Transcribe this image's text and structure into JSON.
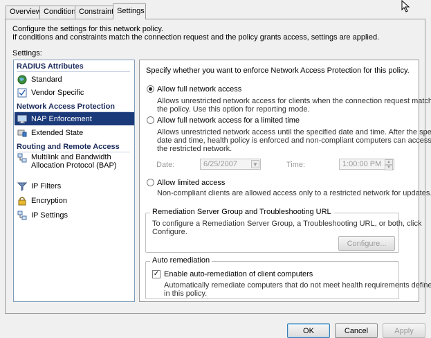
{
  "tabs": [
    {
      "label": "Overview"
    },
    {
      "label": "Conditions"
    },
    {
      "label": "Constraints"
    },
    {
      "label": "Settings",
      "active": true
    }
  ],
  "intro": {
    "line1": "Configure the settings for this network policy.",
    "line2": "If conditions and constraints match the connection request and the policy grants access, settings are applied."
  },
  "settings_label": "Settings:",
  "nav": {
    "sections": [
      {
        "label": "RADIUS Attributes"
      },
      {
        "label": "Network Access Protection"
      },
      {
        "label": "Routing and Remote Access"
      }
    ],
    "items": [
      {
        "label": "Standard",
        "icon": "globe-icon"
      },
      {
        "label": "Vendor Specific",
        "icon": "checklist-icon"
      },
      {
        "label": "NAP Enforcement",
        "icon": "monitor-icon",
        "selected": true
      },
      {
        "label": "Extended State",
        "icon": "flag-icon"
      },
      {
        "label": "Multilink and Bandwidth Allocation Protocol (BAP)",
        "icon": "network-icon"
      },
      {
        "label": "IP Filters",
        "icon": "filter-icon"
      },
      {
        "label": "Encryption",
        "icon": "lock-icon"
      },
      {
        "label": "IP Settings",
        "icon": "network-icon"
      }
    ]
  },
  "content": {
    "heading": "Specify whether you want to enforce Network Access Protection for this policy.",
    "option_full": {
      "label": "Allow full network access",
      "desc1": "Allows unrestricted network access for clients when the connection request matches",
      "desc2": "the policy.  Use this option for reporting mode.",
      "selected": true
    },
    "option_limited_time": {
      "label": "Allow full network access for a limited time",
      "desc1": "Allows unrestricted network access until the specified date and time. After the specified",
      "desc2": "date and time, health policy is enforced and non-compliant computers can access only",
      "desc3": "the restricted network.",
      "selected": false
    },
    "date_label": "Date:",
    "date_value": "6/25/2007",
    "time_label": "Time:",
    "time_value": "1:00:00 PM",
    "option_limited": {
      "label": "Allow limited access",
      "desc": "Non-compliant clients are allowed access only to a restricted network for updates.",
      "selected": false
    },
    "remediation_group": {
      "title": "Remediation Server Group and Troubleshooting URL",
      "desc1": "To configure a Remediation Server Group, a Troubleshooting URL, or both, click",
      "desc2": "Configure.",
      "configure_label": "Configure..."
    },
    "auto_remediation": {
      "title": "Auto remediation",
      "checkbox_label": "Enable auto-remediation of client computers",
      "checked": true,
      "desc1": "Automatically remediate computers that do not meet health requirements defined",
      "desc2": "in this policy."
    }
  },
  "buttons": {
    "ok": "OK",
    "cancel": "Cancel",
    "apply": "Apply"
  }
}
